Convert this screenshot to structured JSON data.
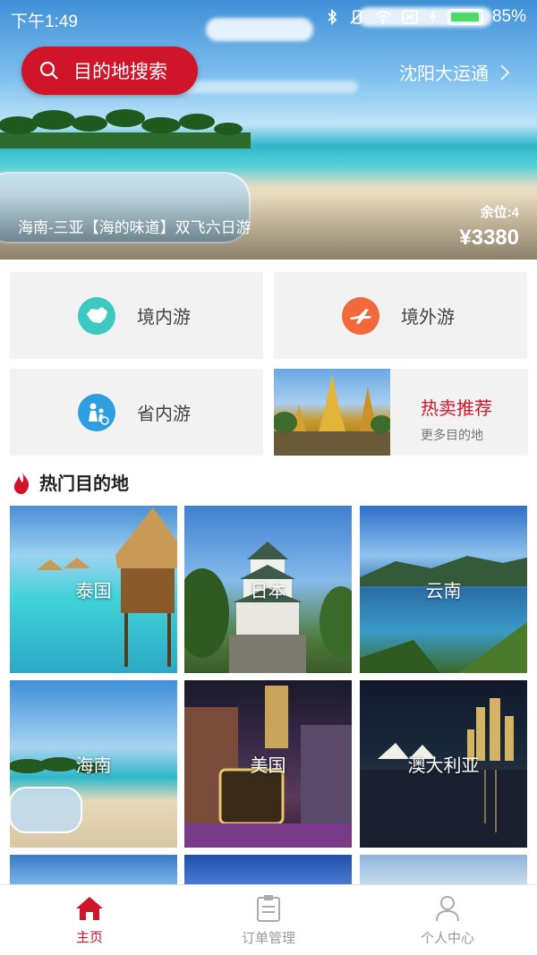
{
  "status": {
    "time": "下午1:49",
    "battery": "85%"
  },
  "hero": {
    "search_label": "目的地搜索",
    "city": "沈阳大运通",
    "title": "海南-三亚【海的味道】双飞六日游",
    "seats": "余位:4",
    "price": "¥3380"
  },
  "categories": {
    "domestic": "境内游",
    "abroad": "境外游",
    "province": "省内游",
    "hot_title": "热卖推荐",
    "hot_sub": "更多目的地"
  },
  "section": {
    "title": "热门目的地"
  },
  "destinations": [
    "泰国",
    "日本",
    "云南",
    "海南",
    "美国",
    "澳大利亚"
  ],
  "tabs": [
    {
      "label": "主页",
      "icon": "home-icon"
    },
    {
      "label": "订单管理",
      "icon": "clipboard-icon"
    },
    {
      "label": "个人中心",
      "icon": "user-icon"
    }
  ],
  "colors": {
    "accent": "#d0152b",
    "domestic": "#3cc9c0",
    "abroad": "#f06a3c",
    "province": "#2f9ee0"
  }
}
